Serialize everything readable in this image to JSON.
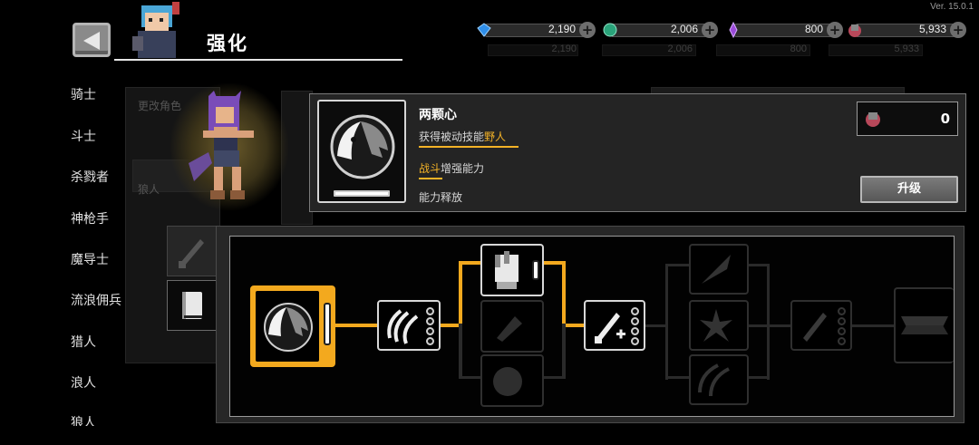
{
  "version": "Ver. 15.0.1",
  "header": {
    "title": "强化"
  },
  "currencies": [
    {
      "name": "gem",
      "value": "2,190",
      "color": "#2f8ee8"
    },
    {
      "name": "token",
      "value": "2,006",
      "color": "#2aa37a"
    },
    {
      "name": "crystal",
      "value": "800",
      "color": "#9a4ad8"
    },
    {
      "name": "ore",
      "value": "5,933",
      "color": "#b8485a"
    }
  ],
  "sidebar": {
    "items": [
      {
        "label": "骑士"
      },
      {
        "label": "斗士"
      },
      {
        "label": "杀戮者"
      },
      {
        "label": "神枪手"
      },
      {
        "label": "魔导士"
      },
      {
        "label": "流浪佣兵"
      },
      {
        "label": "猎人"
      },
      {
        "label": "浪人"
      },
      {
        "label": "狼人"
      }
    ]
  },
  "background": {
    "change_role": "更改角色",
    "row_label": "狼人"
  },
  "skill": {
    "title": "两颗心",
    "line1_prefix": "获得被动技能",
    "line1_highlight": "野人",
    "line2_highlight": "战斗",
    "line2_suffix": "增强能力",
    "line3": "能力释放",
    "cost": "0",
    "upgrade_label": "升级"
  },
  "colors": {
    "accent": "#f3a91e",
    "highlight": "#f3b227"
  }
}
